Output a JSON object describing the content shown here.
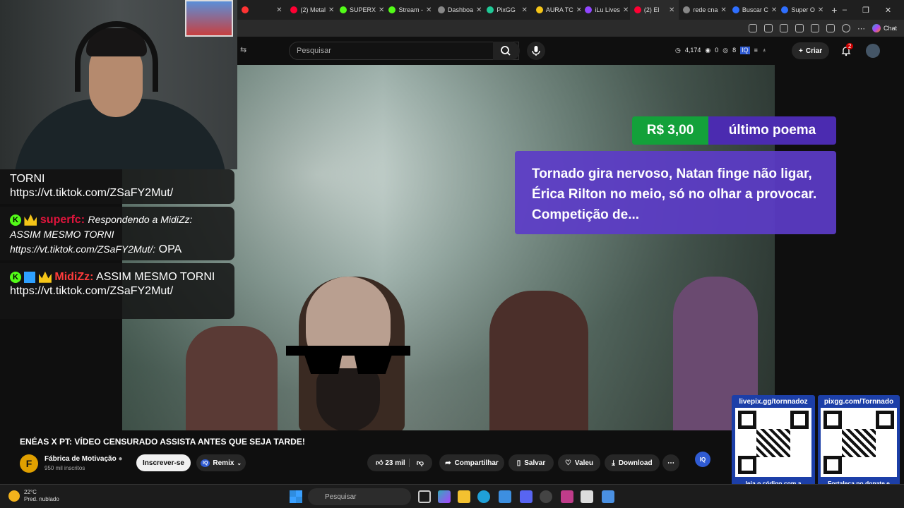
{
  "browser": {
    "tabs": [
      {
        "label": "",
        "color": "#ff3333"
      },
      {
        "label": "(2) Metal",
        "color": "#ff0033"
      },
      {
        "label": "SUPERX",
        "color": "#53fc18"
      },
      {
        "label": "Stream -",
        "color": "#53fc18"
      },
      {
        "label": "Dashboa",
        "color": "#888888"
      },
      {
        "label": "PixGG",
        "color": "#20c997"
      },
      {
        "label": "AURA TC",
        "color": "#f5c518"
      },
      {
        "label": "iLu Lives",
        "color": "#9146ff"
      },
      {
        "label": "(2) El",
        "color": "#ff0033"
      },
      {
        "label": "rede cna",
        "color": "#888888"
      },
      {
        "label": "Buscar C",
        "color": "#2f6fff"
      },
      {
        "label": "Super O",
        "color": "#2f6fff"
      }
    ],
    "new_tab": "+",
    "window_controls": [
      "–",
      "❐",
      "✕"
    ],
    "chat_label": "Chat"
  },
  "youtube": {
    "search_placeholder": "Pesquisar",
    "stats": {
      "count": "4,174",
      "a": "0",
      "b": "8"
    },
    "create_label": "Criar",
    "notif_count": "2"
  },
  "donation": {
    "amount": "R$ 3,00",
    "label": "último poema",
    "message": "Tornado gira nervoso, Natan finge não ligar, Érica Rilton no meio, só no olhar a provocar. Competição de..."
  },
  "chat": {
    "messages": [
      {
        "user": "",
        "reply": "",
        "text1": "TORNI",
        "text2": "https://vt.tiktok.com/ZSaFY2Mut/"
      },
      {
        "user": "superfc:",
        "user_color": "#e0143c",
        "reply": "Respondendo a MidiZz: ASSIM MESMO TORNI https://vt.tiktok.com/ZSaFY2Mut/:",
        "text1": "OPA",
        "text2": ""
      },
      {
        "user": "MidiZz:",
        "user_color": "#ff3b3b",
        "reply": "",
        "text1": "ASSIM MESMO TORNI",
        "text2": "https://vt.tiktok.com/ZSaFY2Mut/"
      }
    ]
  },
  "video": {
    "title": "ENÉAS X PT: VÍDEO CENSURADO ASSISTA ANTES QUE SEJA TARDE!",
    "channel": "Fábrica de Motivação",
    "channel_initial": "F",
    "subscribers": "950 mil inscritos",
    "subscribe_label": "Inscrever-se",
    "remix_label": "Remix",
    "likes": "23 mil",
    "share_label": "Compartilhar",
    "save_label": "Salvar",
    "valeu_label": "Valeu",
    "download_label": "Download",
    "more_label": "⋯",
    "iq_label": "IQ"
  },
  "qr": {
    "left": {
      "title": "livepix.gg/tornnadoz",
      "caption": "leia o código com a câmera do celular."
    },
    "right": {
      "title": "pixgg.com/Tornnado",
      "caption": "Fortaleça no donate e envie sua mensagem!"
    }
  },
  "taskbar": {
    "temp": "22°C",
    "weather": "Pred. nublado",
    "search_placeholder": "Pesquisar"
  }
}
